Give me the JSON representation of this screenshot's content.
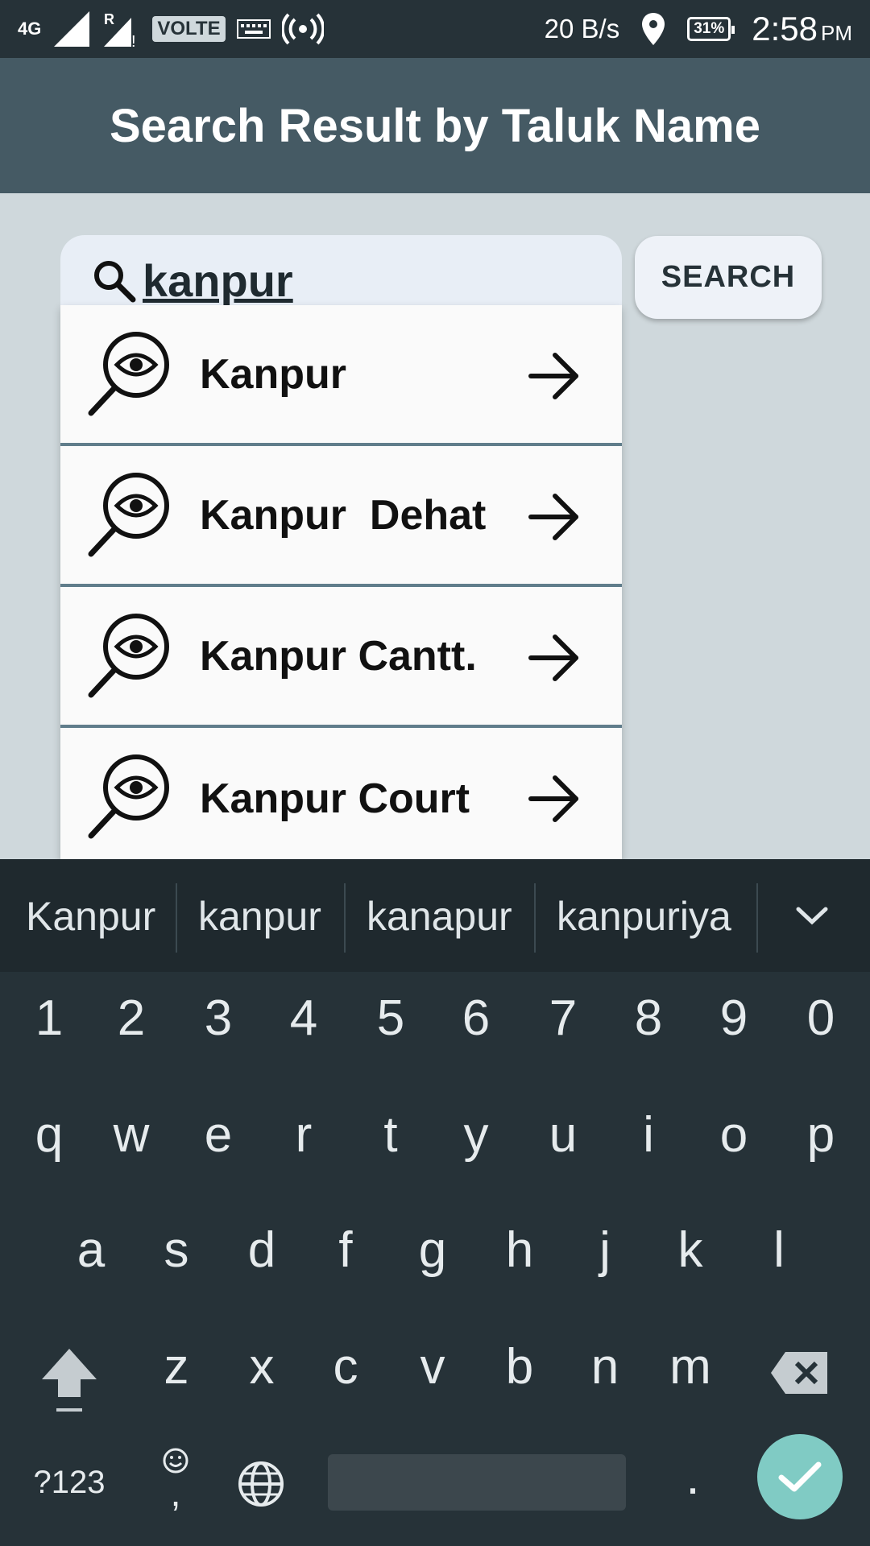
{
  "status_bar": {
    "network": "4G",
    "roaming": "R",
    "volte": "VOLTE",
    "speed": "20 B/s",
    "battery": "31%",
    "time": "2:58",
    "ampm": "PM"
  },
  "header": {
    "title": "Search Result by Taluk Name"
  },
  "search": {
    "query": "kanpur",
    "button_label": "SEARCH"
  },
  "suggestions": [
    {
      "label": "Kanpur"
    },
    {
      "label": "Kanpur  Dehat"
    },
    {
      "label": "Kanpur Cantt."
    },
    {
      "label": "Kanpur Court"
    }
  ],
  "keyboard": {
    "word_suggestions": [
      "Kanpur",
      "kanpur",
      "kanapur",
      "kanpuriya"
    ],
    "row_numbers": [
      "1",
      "2",
      "3",
      "4",
      "5",
      "6",
      "7",
      "8",
      "9",
      "0"
    ],
    "row_q": [
      "q",
      "w",
      "e",
      "r",
      "t",
      "y",
      "u",
      "i",
      "o",
      "p"
    ],
    "row_a": [
      "a",
      "s",
      "d",
      "f",
      "g",
      "h",
      "j",
      "k",
      "l"
    ],
    "row_z": [
      "z",
      "x",
      "c",
      "v",
      "b",
      "n",
      "m"
    ],
    "symbols_label": "?123",
    "comma": ",",
    "period": ".",
    "enter_color": "#80cbc4"
  }
}
